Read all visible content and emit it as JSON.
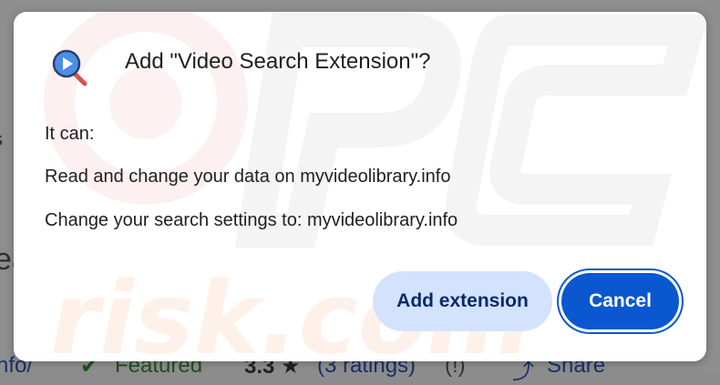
{
  "background": {
    "fragment_left_1": "s",
    "fragment_left_2": "ea",
    "bottom": {
      "link": "nfo/",
      "featured_icon": "verified-icon",
      "featured": "Featured",
      "rating": "3.3 ★",
      "ratings": "(3 ratings)",
      "count": "(!)",
      "share_icon": "share-icon",
      "share": "Share"
    }
  },
  "dialog": {
    "icon": "video-search-extension-icon",
    "title": "Add \"Video Search Extension\"?",
    "it_can": "It can:",
    "permissions": [
      "Read and change your data on myvideolibrary.info",
      "Change your search settings to: myvideolibrary.info"
    ],
    "add_button": "Add extension",
    "cancel_button": "Cancel"
  },
  "colors": {
    "primary": "#0b57d0",
    "tonal": "#d3e3fd",
    "text": "#1f1f1f"
  }
}
